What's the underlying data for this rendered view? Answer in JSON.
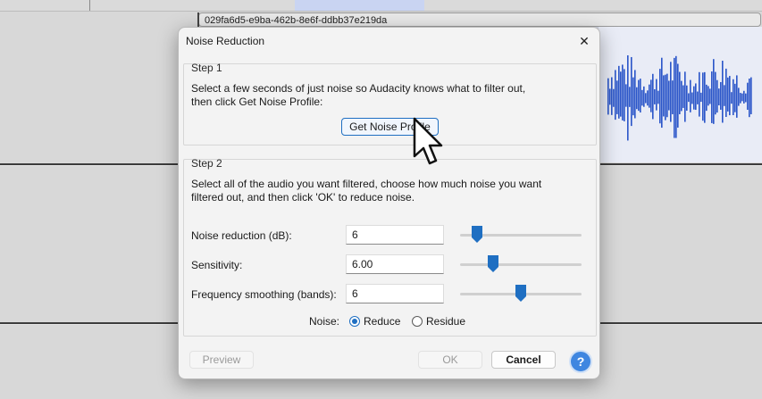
{
  "clip": {
    "name": "029fa6d5-e9ba-462b-8e6f-ddbb37e219da"
  },
  "dialog": {
    "title": "Noise Reduction",
    "close_glyph": "✕",
    "step1": {
      "title": "Step 1",
      "description_line1": "Select a few seconds of just noise so Audacity knows what to filter out,",
      "description_line2": "then click Get Noise Profile:",
      "button_label": "Get Noise Profile"
    },
    "step2": {
      "title": "Step 2",
      "description_line1": "Select all of the audio you want filtered, choose how much noise you want",
      "description_line2": "filtered out, and then click 'OK' to reduce noise.",
      "rows": [
        {
          "label": "Noise reduction (dB):",
          "value": "6",
          "slider_fraction": 0.14
        },
        {
          "label": "Sensitivity:",
          "value": "6.00",
          "slider_fraction": 0.27
        },
        {
          "label": "Frequency smoothing (bands):",
          "value": "6",
          "slider_fraction": 0.5
        }
      ],
      "noise_label": "Noise:",
      "options": [
        {
          "label": "Reduce",
          "selected": true
        },
        {
          "label": "Residue",
          "selected": false
        }
      ]
    },
    "footer": {
      "preview_label": "Preview",
      "ok_label": "OK",
      "cancel_label": "Cancel",
      "help_glyph": "?"
    }
  },
  "colors": {
    "accent": "#1f6fc2",
    "waveform": "#2a55c9",
    "help": "#3f86e0"
  },
  "icons": [
    "close-icon",
    "help-icon",
    "mouse-pointer-icon"
  ]
}
